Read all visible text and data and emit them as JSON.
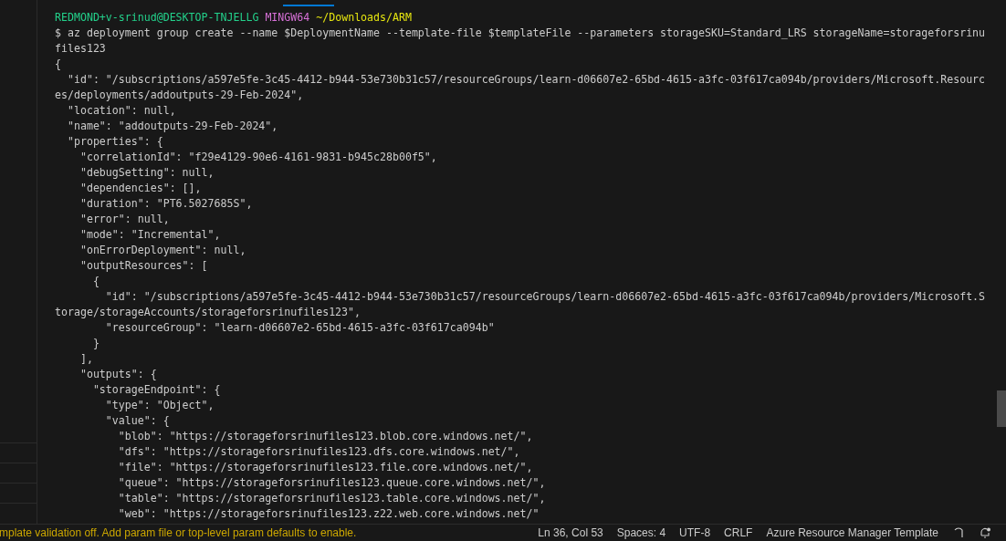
{
  "terminal": {
    "prompt": {
      "user_host": "REDMOND+v-srinud@DESKTOP-TNJELLG",
      "system": "MINGW64",
      "path": "~/Downloads/ARM"
    },
    "lines": [
      "$ az deployment group create --name $DeploymentName --template-file $templateFile --parameters storageSKU=Standard_LRS storageName=storageforsrinu",
      "files123",
      "{",
      "  \"id\": \"/subscriptions/a597e5fe-3c45-4412-b944-53e730b31c57/resourceGroups/learn-d06607e2-65bd-4615-a3fc-03f617ca094b/providers/Microsoft.Resourc",
      "es/deployments/addoutputs-29-Feb-2024\",",
      "  \"location\": null,",
      "  \"name\": \"addoutputs-29-Feb-2024\",",
      "  \"properties\": {",
      "    \"correlationId\": \"f29e4129-90e6-4161-9831-b945c28b00f5\",",
      "    \"debugSetting\": null,",
      "    \"dependencies\": [],",
      "    \"duration\": \"PT6.5027685S\",",
      "    \"error\": null,",
      "    \"mode\": \"Incremental\",",
      "    \"onErrorDeployment\": null,",
      "    \"outputResources\": [",
      "      {",
      "        \"id\": \"/subscriptions/a597e5fe-3c45-4412-b944-53e730b31c57/resourceGroups/learn-d06607e2-65bd-4615-a3fc-03f617ca094b/providers/Microsoft.S",
      "torage/storageAccounts/storageforsrinufiles123\",",
      "        \"resourceGroup\": \"learn-d06607e2-65bd-4615-a3fc-03f617ca094b\"",
      "      }",
      "    ],",
      "    \"outputs\": {",
      "      \"storageEndpoint\": {",
      "        \"type\": \"Object\",",
      "        \"value\": {",
      "          \"blob\": \"https://storageforsrinufiles123.blob.core.windows.net/\",",
      "          \"dfs\": \"https://storageforsrinufiles123.dfs.core.windows.net/\",",
      "          \"file\": \"https://storageforsrinufiles123.file.core.windows.net/\",",
      "          \"queue\": \"https://storageforsrinufiles123.queue.core.windows.net/\",",
      "          \"table\": \"https://storageforsrinufiles123.table.core.windows.net/\",",
      "          \"web\": \"https://storageforsrinufiles123.z22.web.core.windows.net/\""
    ]
  },
  "status_bar": {
    "warning": "mplate validation off. Add param file or top-level param defaults to enable.",
    "items": [
      "Ln 36, Col 53",
      "Spaces: 4",
      "UTF-8",
      "CRLF",
      "Azure Resource Manager Template"
    ]
  }
}
